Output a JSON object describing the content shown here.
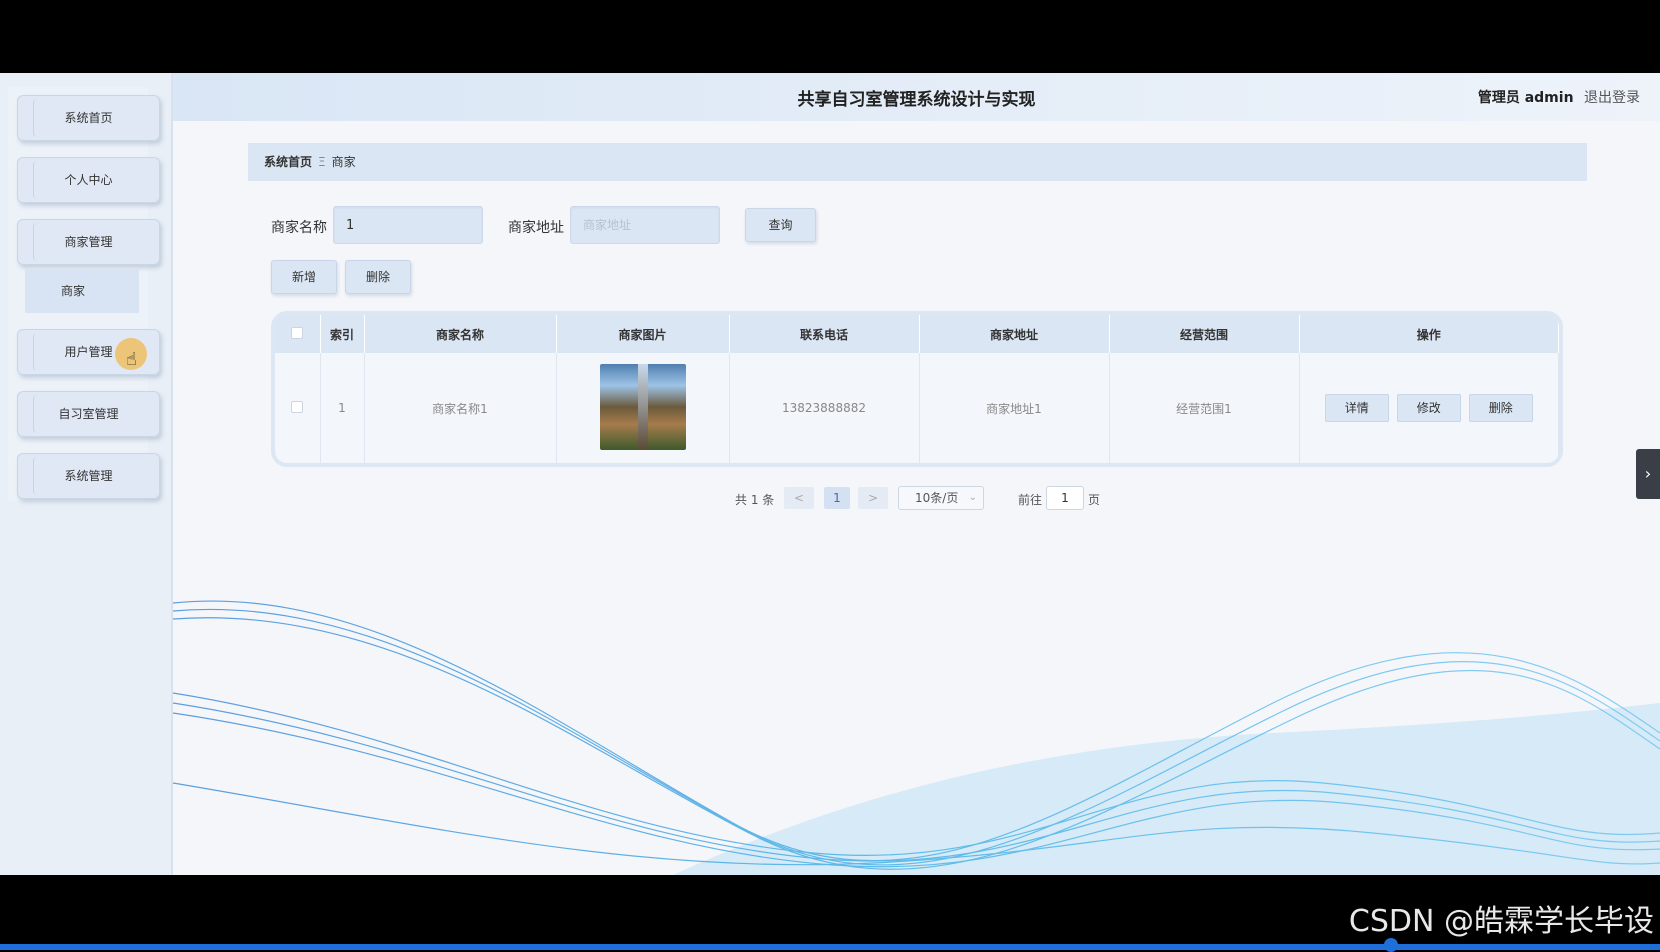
{
  "header": {
    "title": "共享自习室管理系统设计与实现",
    "user_label": "管理员 admin",
    "logout_label": "退出登录"
  },
  "sidebar": {
    "items": [
      {
        "label": "系统首页"
      },
      {
        "label": "个人中心"
      },
      {
        "label": "商家管理"
      },
      {
        "label": "用户管理"
      },
      {
        "label": "自习室管理"
      },
      {
        "label": "系统管理"
      }
    ],
    "submenu": {
      "label": "商家"
    }
  },
  "breadcrumb": {
    "home": "系统首页",
    "separator": "Ξ",
    "current": "商家"
  },
  "search": {
    "name_label": "商家名称",
    "name_value": "1",
    "address_label": "商家地址",
    "address_placeholder": "商家地址",
    "query_label": "查询"
  },
  "toolbar": {
    "add_label": "新增",
    "delete_label": "删除"
  },
  "table": {
    "headers": [
      "索引",
      "商家名称",
      "商家图片",
      "联系电话",
      "商家地址",
      "经营范围",
      "操作"
    ],
    "rows": [
      {
        "index": "1",
        "name": "商家名称1",
        "phone": "13823888882",
        "address": "商家地址1",
        "scope": "经营范围1"
      }
    ],
    "actions": {
      "detail": "详情",
      "edit": "修改",
      "delete": "删除"
    }
  },
  "pagination": {
    "total": "共 1 条",
    "prev": "<",
    "page": "1",
    "next": ">",
    "page_size": "10条/页",
    "goto_prefix": "前往",
    "goto_value": "1",
    "goto_suffix": "页"
  },
  "side_tab": {
    "icon": "chevron-right-icon",
    "glyph": "›"
  },
  "watermark": "CSDN @皓霖学长毕设",
  "colors": {
    "accent": "#dbe6f4",
    "progress": "#1e6fd9"
  }
}
